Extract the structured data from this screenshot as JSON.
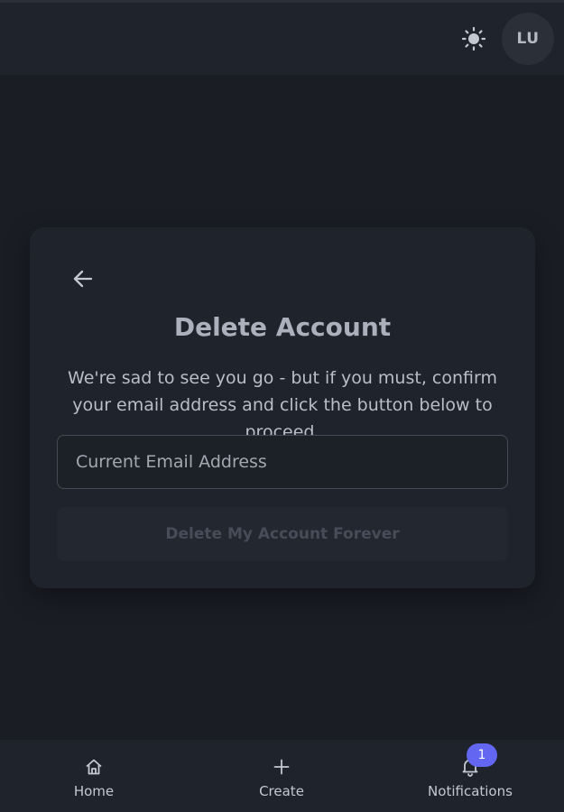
{
  "header": {
    "theme_toggle_icon": "sun-icon",
    "avatar_initials": "LU"
  },
  "card": {
    "back_icon": "arrow-left-icon",
    "title": "Delete Account",
    "description": "We're sad to see you go - but if you must, confirm your email address and click the button below to proceed.",
    "email_input": {
      "value": "",
      "placeholder": "Current Email Address"
    },
    "delete_button_label": "Delete My Account Forever",
    "delete_button_disabled": true
  },
  "bottom_nav": {
    "items": [
      {
        "label": "Home",
        "icon": "home-icon"
      },
      {
        "label": "Create",
        "icon": "plus-icon"
      },
      {
        "label": "Notifications",
        "icon": "bell-icon",
        "badge": "1"
      }
    ]
  },
  "colors": {
    "background": "#1a1d24",
    "surface": "#1f232b",
    "accent": "#6366f1"
  }
}
